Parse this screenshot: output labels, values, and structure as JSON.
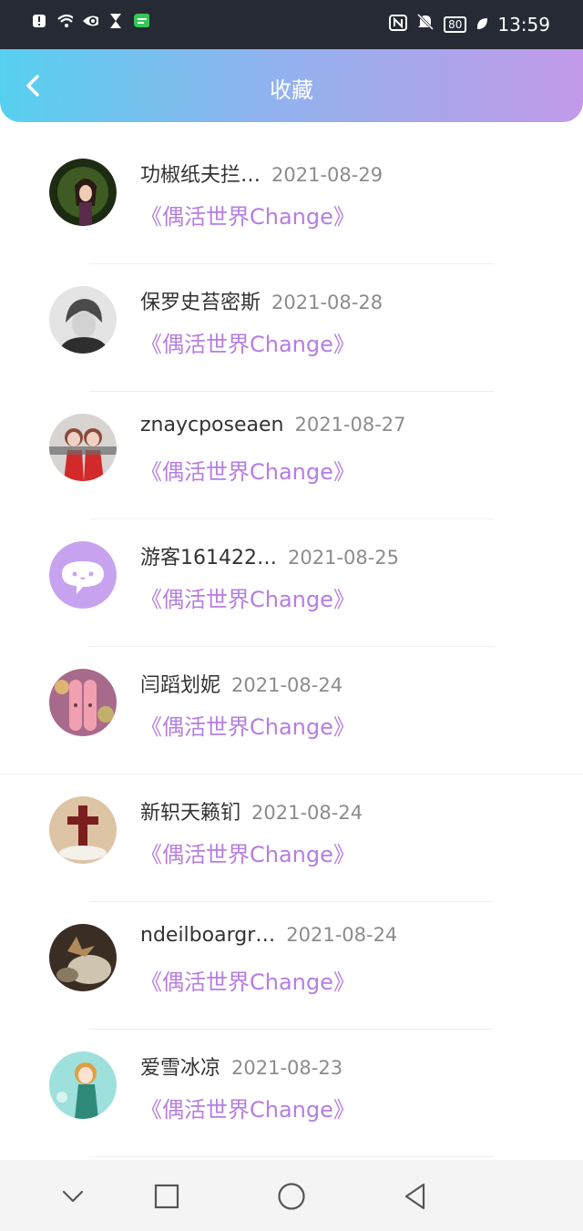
{
  "status_bar": {
    "time": "13:59",
    "battery": "80",
    "left_icons": [
      "alert-icon",
      "wifi-icon",
      "eye-icon",
      "hourglass-icon",
      "chat-icon"
    ],
    "right_icons": [
      "nfc-icon",
      "mute-icon",
      "battery-icon",
      "leaf-icon"
    ]
  },
  "header": {
    "title": "收藏"
  },
  "items": [
    {
      "name": "功椒纸夫拦…",
      "date": "2021-08-29",
      "book": "《偶活世界Change》"
    },
    {
      "name": "保罗史苔密斯",
      "date": "2021-08-28",
      "book": "《偶活世界Change》"
    },
    {
      "name": "znaycposeaen",
      "date": "2021-08-27",
      "book": "《偶活世界Change》"
    },
    {
      "name": "游客161422…",
      "date": "2021-08-25",
      "book": "《偶活世界Change》"
    },
    {
      "name": "闫蹈划妮",
      "date": "2021-08-24",
      "book": "《偶活世界Change》"
    },
    {
      "name": "新轵天籁钔",
      "date": "2021-08-24",
      "book": "《偶活世界Change》"
    },
    {
      "name": "ndeilboargr…",
      "date": "2021-08-24",
      "book": "《偶活世界Change》"
    },
    {
      "name": "爱雪冰凉",
      "date": "2021-08-23",
      "book": "《偶活世界Change》"
    }
  ],
  "nav": {
    "icons": [
      "collapse-icon",
      "recents-icon",
      "home-icon",
      "back-icon"
    ]
  },
  "colors": {
    "accent": "#b57ee0",
    "header_gradient": [
      "#57d0ef",
      "#c29ae9"
    ]
  }
}
